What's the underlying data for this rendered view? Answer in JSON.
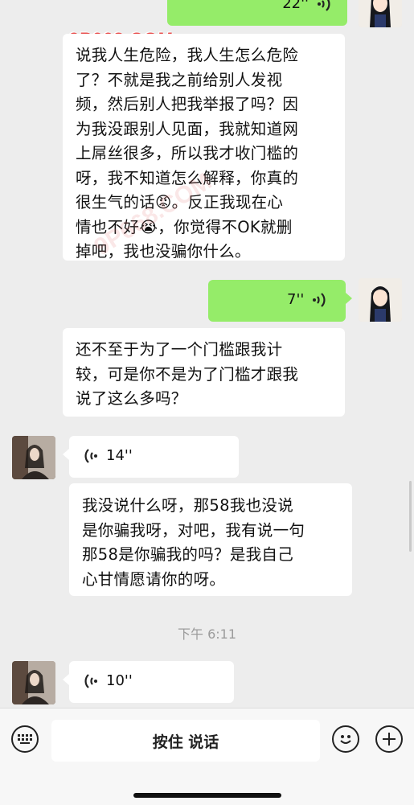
{
  "watermark": {
    "text": "9P668.COM",
    "faint_text": "9P668.COM"
  },
  "messages": {
    "m0": {
      "duration": "22''"
    },
    "m1": {
      "text": "说我人生危险，我人生怎么危险\n了？不就是我之前给别人发视\n频，然后别人把我举报了吗？因\n为我没跟别人见面，我就知道网\n上屌丝很多，所以我才收门槛的\n呀，我不知道怎么解释，你真的\n很生气的话😡。反正我现在心\n情也不好😭，你觉得不OK就删\n掉吧，我也没骗你什么。"
    },
    "m2": {
      "duration": "7''"
    },
    "m3": {
      "text": "还不至于为了一个门槛跟我计\n较，可是你不是为了门槛才跟我\n说了这么多吗？"
    },
    "m4": {
      "duration": "14''"
    },
    "m5": {
      "text": "我没说什么呀，那58我也没说\n是你骗我呀，对吧，我有说一句\n那58是你骗我的吗？是我自己\n心甘情愿请你的呀。"
    },
    "m6": {
      "duration": "10''"
    }
  },
  "timestamp": "下午 6:11",
  "bottom_bar": {
    "hold_to_talk": "按住 说话"
  },
  "icons": {
    "voice_input": "keyboard-icon",
    "emoji": "emoji-icon",
    "more": "plus-icon",
    "voice_wave": "voice-wave-icon"
  },
  "colors": {
    "background": "#ededed",
    "self_bubble": "#95ec69",
    "other_bubble": "#ffffff"
  }
}
